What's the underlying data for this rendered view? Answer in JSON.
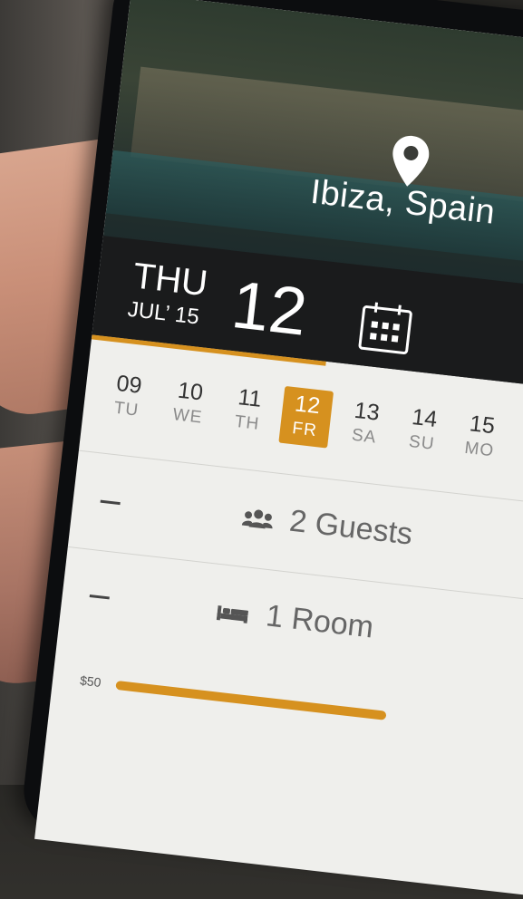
{
  "location": {
    "text": "Ibiza, Spain"
  },
  "date": {
    "dow": "THU",
    "month": "JUL’ 15",
    "day": "12"
  },
  "days": [
    {
      "n": "09",
      "w": "TU",
      "selected": false
    },
    {
      "n": "10",
      "w": "WE",
      "selected": false
    },
    {
      "n": "11",
      "w": "TH",
      "selected": false
    },
    {
      "n": "12",
      "w": "FR",
      "selected": true
    },
    {
      "n": "13",
      "w": "SA",
      "selected": false
    },
    {
      "n": "14",
      "w": "SU",
      "selected": false
    },
    {
      "n": "15",
      "w": "MO",
      "selected": false
    }
  ],
  "guests": {
    "label": "2 Guests"
  },
  "rooms": {
    "label": "1 Room"
  },
  "price": {
    "min": "$50",
    "progress": 0.55
  },
  "colors": {
    "accent": "#d6911f",
    "dark": "#1a1b1c",
    "panel": "#efefec"
  }
}
